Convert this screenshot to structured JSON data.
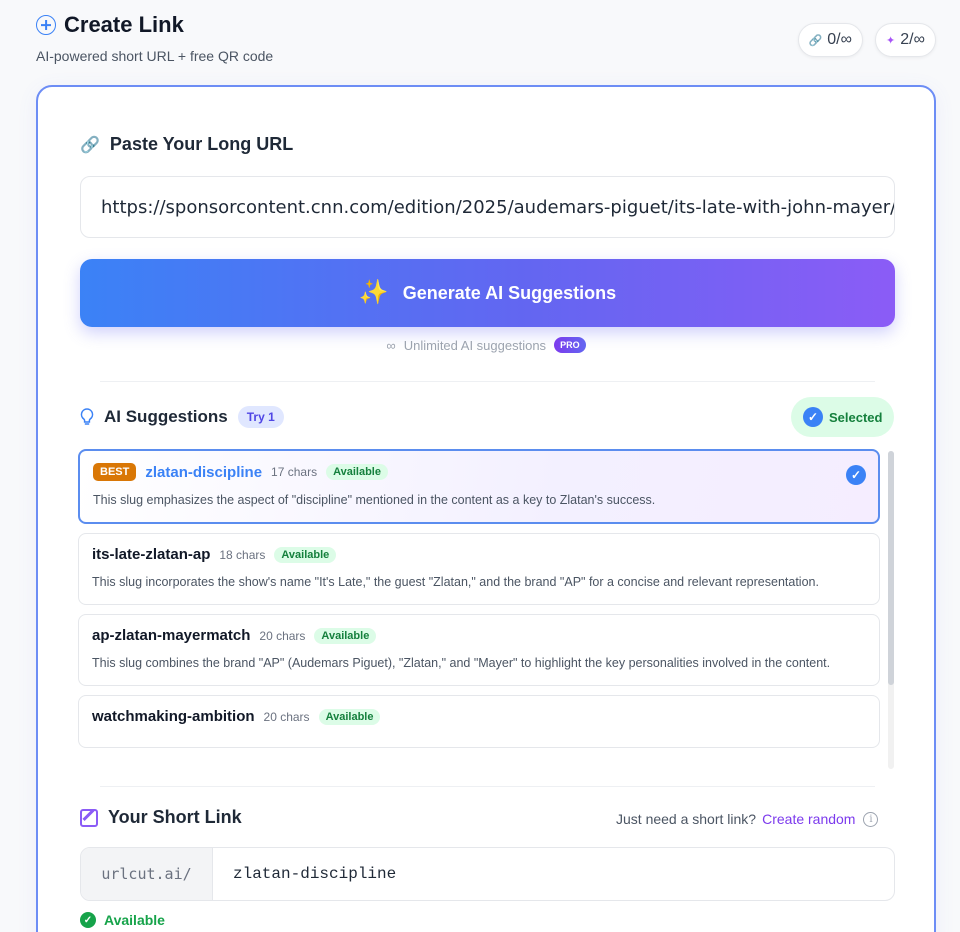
{
  "header": {
    "title": "Create Link",
    "subtitle": "AI-powered short URL + free QR code"
  },
  "counters": [
    {
      "icon": "link-icon",
      "value": "0/∞"
    },
    {
      "icon": "sparkle-icon",
      "value": "2/∞"
    }
  ],
  "url_section": {
    "label": "Paste Your Long URL",
    "value": "https://sponsorcontent.cnn.com/edition/2025/audemars-piguet/its-late-with-john-mayer/zl"
  },
  "generate": {
    "label": "Generate AI Suggestions",
    "unlimited_text": "Unlimited AI suggestions",
    "pro_badge": "PRO"
  },
  "suggestions": {
    "heading": "AI Suggestions",
    "try_badge": "Try 1",
    "selected_label": "Selected",
    "items": [
      {
        "slug": "zlatan-discipline",
        "chars": "17 chars",
        "status": "Available",
        "best": "BEST",
        "desc": "This slug emphasizes the aspect of \"discipline\" mentioned in the content as a key to Zlatan's success."
      },
      {
        "slug": "its-late-zlatan-ap",
        "chars": "18 chars",
        "status": "Available",
        "desc": "This slug incorporates the show's name \"It's Late,\" the guest \"Zlatan,\" and the brand \"AP\" for a concise and relevant representation."
      },
      {
        "slug": "ap-zlatan-mayermatch",
        "chars": "20 chars",
        "status": "Available",
        "desc": "This slug combines the brand \"AP\" (Audemars Piguet), \"Zlatan,\" and \"Mayer\" to highlight the key personalities involved in the content."
      },
      {
        "slug": "watchmaking-ambition",
        "chars": "20 chars",
        "status": "Available",
        "desc": ""
      }
    ]
  },
  "short_link": {
    "heading": "Your Short Link",
    "helper_text": "Just need a short link?",
    "create_random": "Create random",
    "prefix": "urlcut.ai/",
    "slug": "zlatan-discipline",
    "status": "Available"
  },
  "colors": {
    "accent": "#3b82f6",
    "purple": "#8b5cf6",
    "success": "#16a34a",
    "best_badge": "#d97706"
  }
}
